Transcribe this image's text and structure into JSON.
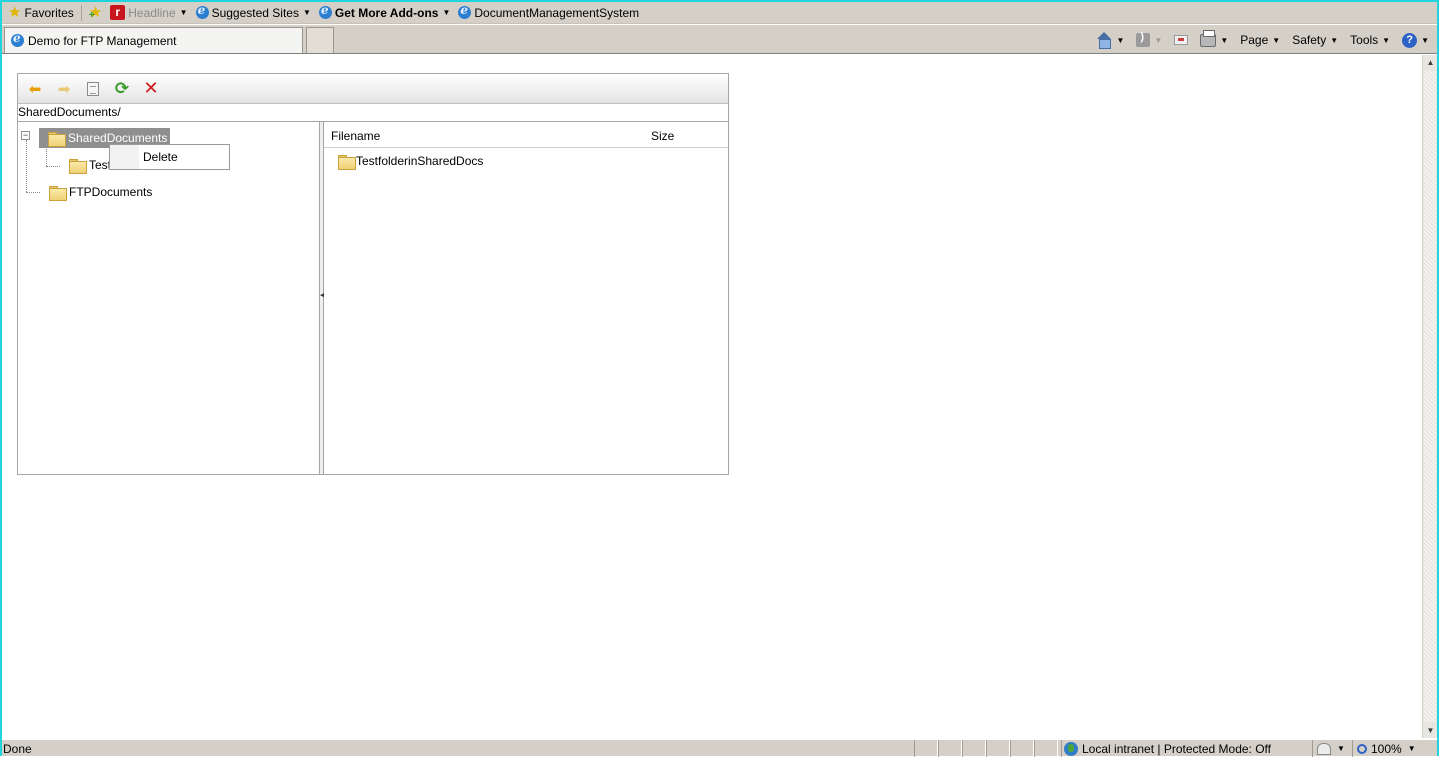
{
  "favorites_bar": {
    "favorites_label": "Favorites",
    "items": [
      {
        "label": "Headline",
        "icon": "headline-icon",
        "disabled": true,
        "dropdown": true
      },
      {
        "label": "Suggested Sites",
        "icon": "ie-icon",
        "dropdown": true
      },
      {
        "label": "Get More Add-ons",
        "icon": "ie-icon",
        "bold": true,
        "dropdown": true
      },
      {
        "label": "DocumentManagementSystem",
        "icon": "ie-icon"
      }
    ]
  },
  "tab": {
    "title": "Demo for FTP Management"
  },
  "command_bar": {
    "page_label": "Page",
    "safety_label": "Safety",
    "tools_label": "Tools"
  },
  "file_manager": {
    "toolbar": [
      "back-icon",
      "forward-icon",
      "properties-icon",
      "refresh-icon",
      "delete-icon"
    ],
    "path": "SharedDocuments/",
    "tree": {
      "root_selected": "SharedDocuments",
      "child_partial": "Test",
      "second_root": "FTPDocuments"
    },
    "context_menu": {
      "item": "Delete"
    },
    "list": {
      "col_filename": "Filename",
      "col_size": "Size",
      "rows": [
        {
          "name": "TestfolderinSharedDocs",
          "size": ""
        }
      ]
    }
  },
  "status_bar": {
    "status": "Done",
    "zone": "Local intranet | Protected Mode: Off",
    "zoom": "100%"
  },
  "colors": {
    "accent": "#21d3dd",
    "selection": "#8f8f8f",
    "chrome": "#d4d0c8"
  }
}
